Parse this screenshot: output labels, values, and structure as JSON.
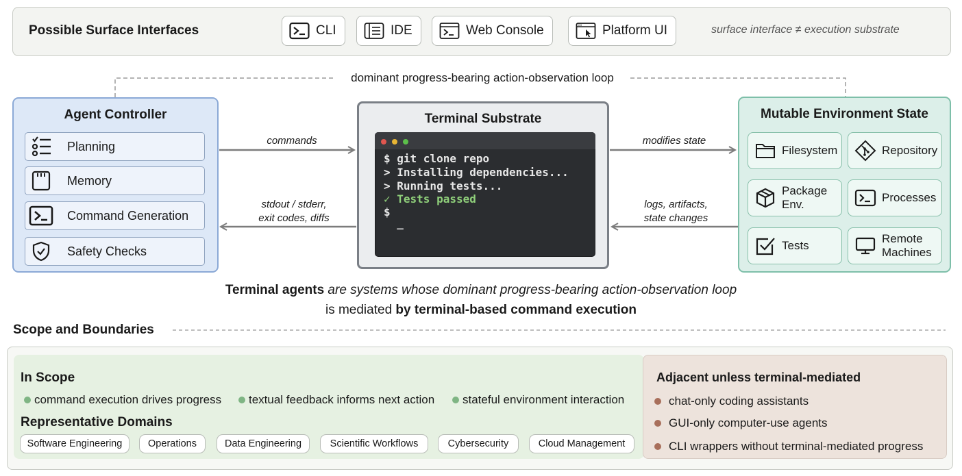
{
  "surface": {
    "title": "Possible Surface Interfaces",
    "interfaces": [
      {
        "label": "CLI",
        "icon": "terminal-prompt-icon"
      },
      {
        "label": "IDE",
        "icon": "editor-icon"
      },
      {
        "label": "Web Console",
        "icon": "web-terminal-icon"
      },
      {
        "label": "Platform UI",
        "icon": "window-cursor-icon"
      }
    ],
    "note": "surface interface ≠ execution substrate"
  },
  "loop": {
    "label": "dominant progress-bearing action-observation loop"
  },
  "agent": {
    "title": "Agent Controller",
    "items": [
      {
        "label": "Planning",
        "icon": "checklist-icon"
      },
      {
        "label": "Memory",
        "icon": "memory-card-icon"
      },
      {
        "label": "Command Generation",
        "icon": "terminal-prompt-icon"
      },
      {
        "label": "Safety Checks",
        "icon": "shield-check-icon"
      }
    ]
  },
  "arrows": {
    "commands": "commands",
    "feedback_line1": "stdout / stderr,",
    "feedback_line2": "exit codes, diffs",
    "modifies": "modifies state",
    "logs_line1": "logs, artifacts,",
    "logs_line2": "state changes"
  },
  "terminal": {
    "title": "Terminal Substrate",
    "lines": [
      "$ git clone repo",
      "> Installing dependencies...",
      "> Running tests...",
      "✓ Tests passed",
      "$",
      "  _"
    ],
    "success_color": "#8fcf7a"
  },
  "environment": {
    "title": "Mutable Environment State",
    "items": [
      {
        "label": "Filesystem",
        "icon": "folder-icon"
      },
      {
        "label": "Repository",
        "icon": "git-icon"
      },
      {
        "label": "Package Env.",
        "icon": "package-icon"
      },
      {
        "label": "Processes",
        "icon": "terminal-prompt-icon"
      },
      {
        "label": "Tests",
        "icon": "checkbox-icon"
      },
      {
        "label": "Remote Machines",
        "icon": "monitor-icon"
      }
    ]
  },
  "definition": {
    "bold1": "Terminal agents",
    "italic1": " are systems whose dominant progress-bearing action-observation loop",
    "plain2": "is mediated ",
    "bold2": "by terminal-based command execution"
  },
  "scope": {
    "title": "Scope and Boundaries",
    "in_scope": {
      "title": "In Scope",
      "bullets": [
        "command execution drives progress",
        "textual feedback informs next action",
        "stateful environment interaction"
      ],
      "domains_title": "Representative Domains",
      "domains": [
        "Software Engineering",
        "Operations",
        "Data Engineering",
        "Scientific Workflows",
        "Cybersecurity",
        "Cloud Management"
      ]
    },
    "adjacent": {
      "title": "Adjacent unless terminal-mediated",
      "items": [
        "chat-only coding assistants",
        "GUI-only computer-use agents",
        "CLI wrappers without terminal-mediated progress"
      ]
    }
  }
}
